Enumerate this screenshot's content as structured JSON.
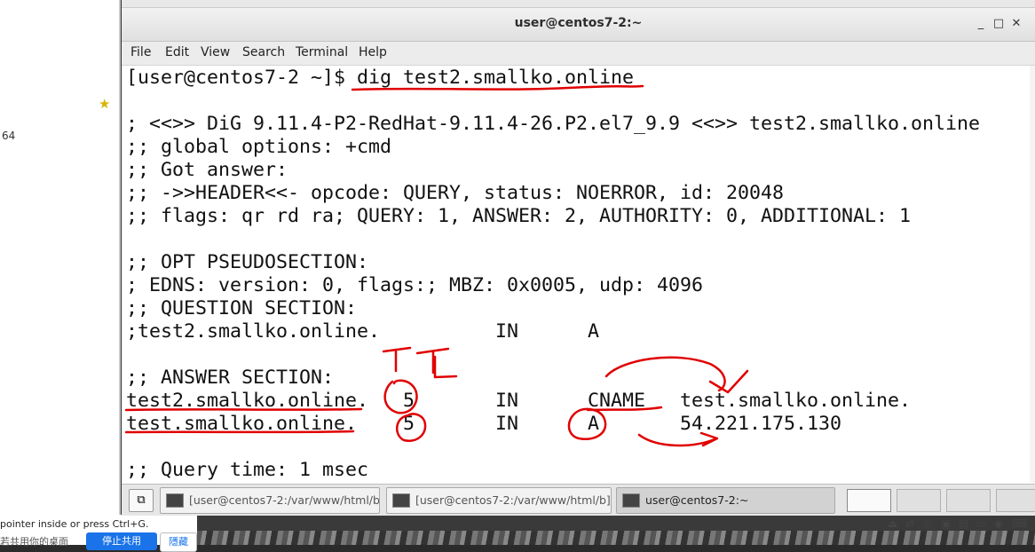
{
  "left_panel": {
    "star_icon": "star-icon",
    "number_text": "64",
    "hint_text": "pointer inside or press Ctrl+G.",
    "zh_text": "若共用你的桌面",
    "btn_primary": "停止共用",
    "btn_secondary": "隱藏"
  },
  "window": {
    "title": "user@centos7-2:~",
    "controls": [
      "minimize-icon",
      "maximize-icon",
      "close-icon"
    ],
    "menu": [
      "File",
      "Edit",
      "View",
      "Search",
      "Terminal",
      "Help"
    ]
  },
  "terminal": {
    "lines": [
      "[user@centos7-2 ~]$ dig test2.smallko.online",
      "",
      "; <<>> DiG 9.11.4-P2-RedHat-9.11.4-26.P2.el7_9.9 <<>> test2.smallko.online",
      ";; global options: +cmd",
      ";; Got answer:",
      ";; ->>HEADER<<- opcode: QUERY, status: NOERROR, id: 20048",
      ";; flags: qr rd ra; QUERY: 1, ANSWER: 2, AUTHORITY: 0, ADDITIONAL: 1",
      "",
      ";; OPT PSEUDOSECTION:",
      "; EDNS: version: 0, flags:; MBZ: 0x0005, udp: 4096",
      ";; QUESTION SECTION:",
      ";test2.smallko.online.          IN      A",
      "",
      ";; ANSWER SECTION:",
      "test2.smallko.online.   5       IN      CNAME   test.smallko.online.",
      "test.smallko.online.    5       IN      A       54.221.175.130",
      "",
      ";; Query time: 1 msec"
    ],
    "annotation_text": "TTL"
  },
  "taskbar": {
    "show_desktop_icon": "show-desktop-icon",
    "tasks": [
      {
        "label": "[user@centos7-2:/var/www/html/b]",
        "active": false
      },
      {
        "label": "[user@centos7-2:/var/www/html/b]",
        "active": false
      },
      {
        "label": "user@centos7-2:~",
        "active": true
      }
    ],
    "workspaces": [
      true,
      false,
      false,
      false
    ]
  },
  "colors": {
    "annotation": "#e00000",
    "blue_button": "#1a73e8"
  }
}
